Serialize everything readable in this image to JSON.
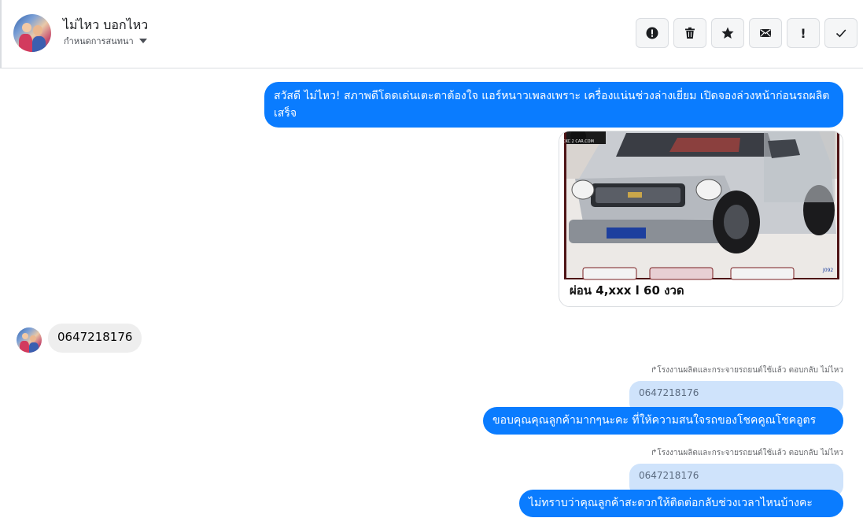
{
  "header": {
    "name": "ไม่ไหว บอกไหว",
    "subtitle": "กำหนดการสนทนา",
    "actions": [
      {
        "icon": "alert-circle-icon",
        "label": ""
      },
      {
        "icon": "trash-icon",
        "label": ""
      },
      {
        "icon": "star-icon",
        "label": ""
      },
      {
        "icon": "mail-icon",
        "label": ""
      },
      {
        "icon": "exclamation-icon",
        "label": "!"
      },
      {
        "icon": "check-icon",
        "label": ""
      }
    ]
  },
  "messages": {
    "greeting": "สวัสดี ไม่ไหว! สภาพดีโดดเด่นเตะตาต้องใจ แอร์หนาวเพลงเพราะ เครื่องแน่นช่วงล่างเยี่ยม เปิดจองล่วงหน้าก่อนรถผลิตเสร็จ",
    "card_caption": "ผ่อน 4,xxx l 60 งวด",
    "card_watermark": "CKC 2 CAR.COM",
    "card_tag": "J092",
    "incoming_phone": "0647218176",
    "reply_note_1": "โรงงานผลิตและกระจายรถยนต์ใช้แล้ว ตอบกลับ ไม่ไหว",
    "quote_1": "0647218176",
    "reply_1": "ขอบคุณคุณลูกค้ามากๆนะคะ ที่ให้ความสนใจรถของโชคคูณโชคอูตร",
    "reply_note_2": "โรงงานผลิตและกระจายรถยนต์ใช้แล้ว ตอบกลับ ไม่ไหว",
    "quote_2": "0647218176",
    "reply_2": "ไม่ทราบว่าคุณลูกค้าสะดวกให้ติดต่อกลับช่วงเวลาไหนบ้างคะ"
  },
  "colors": {
    "outgoing_bubble": "#0a7cff",
    "incoming_bubble": "#eeeeee",
    "quote_bubble": "#cfe3fb",
    "toolbar_bg": "#f5f6f7"
  }
}
